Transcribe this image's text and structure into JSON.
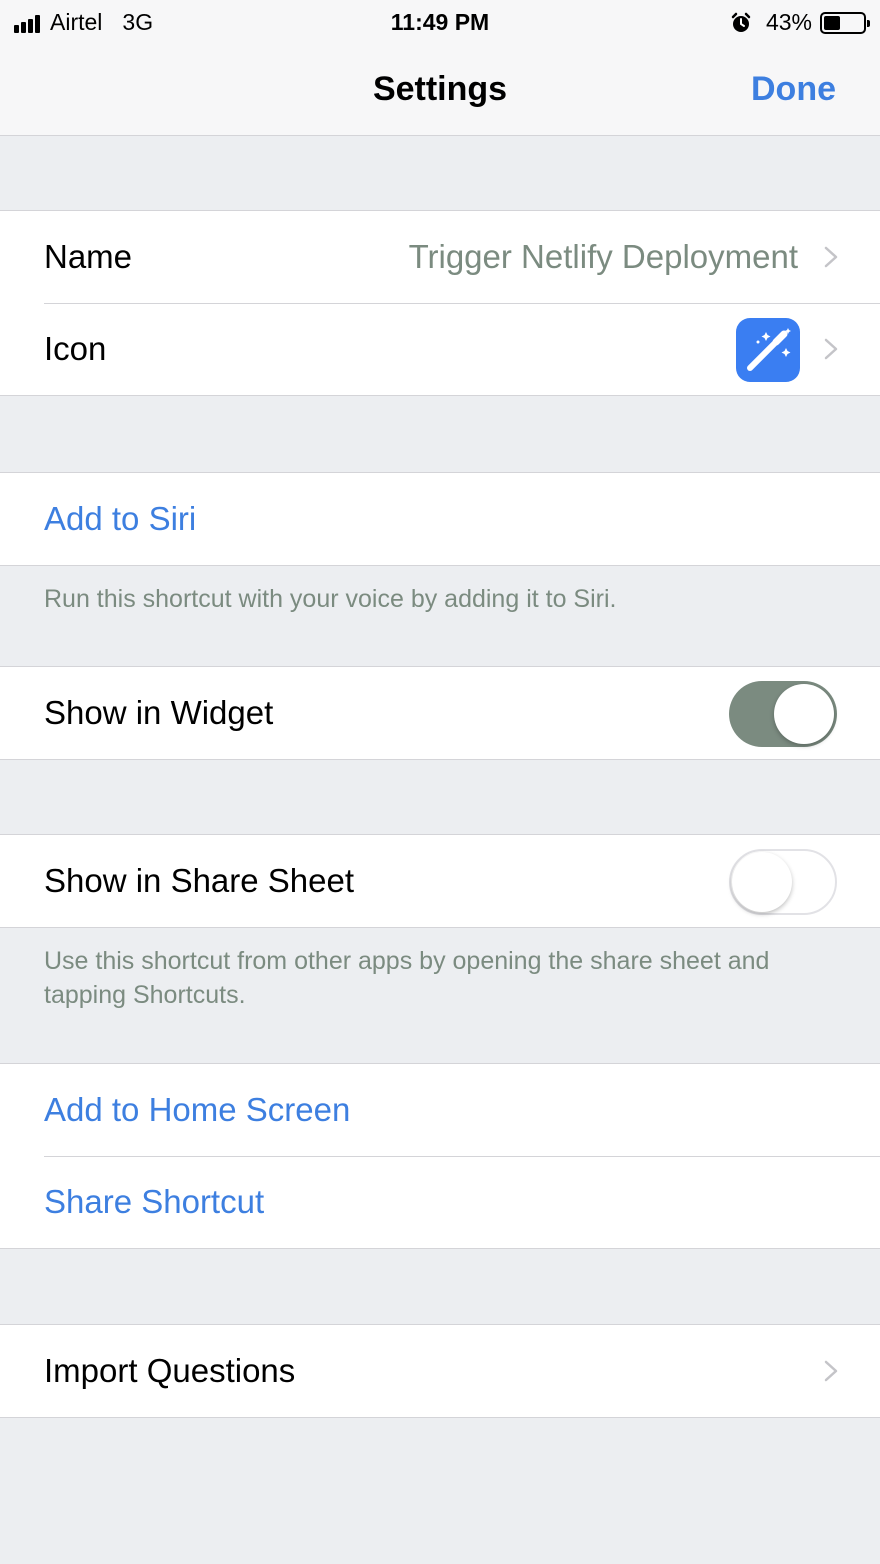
{
  "status_bar": {
    "carrier": "Airtel",
    "network": "3G",
    "time": "11:49 PM",
    "battery": "43%",
    "battery_level": 0.43
  },
  "nav": {
    "title": "Settings",
    "done_label": "Done"
  },
  "name_row": {
    "label": "Name",
    "value": "Trigger Netlify Deployment"
  },
  "icon_row": {
    "label": "Icon",
    "icon": "magic-wand-icon",
    "icon_color": "#3a7ef2"
  },
  "siri": {
    "label": "Add to Siri",
    "footer": "Run this shortcut with your voice by adding it to Siri."
  },
  "widget": {
    "label": "Show in Widget",
    "on": true
  },
  "share_sheet": {
    "label": "Show in Share Sheet",
    "on": false,
    "footer": "Use this shortcut from other apps by opening the share sheet and tapping Shortcuts."
  },
  "actions": {
    "add_home": "Add to Home Screen",
    "share": "Share Shortcut"
  },
  "import_row": {
    "label": "Import Questions"
  },
  "colors": {
    "accent": "#3d7fe0",
    "toggle_on": "#7b8b80",
    "secondary_text": "#7b8b80",
    "background": "#eceef1"
  }
}
